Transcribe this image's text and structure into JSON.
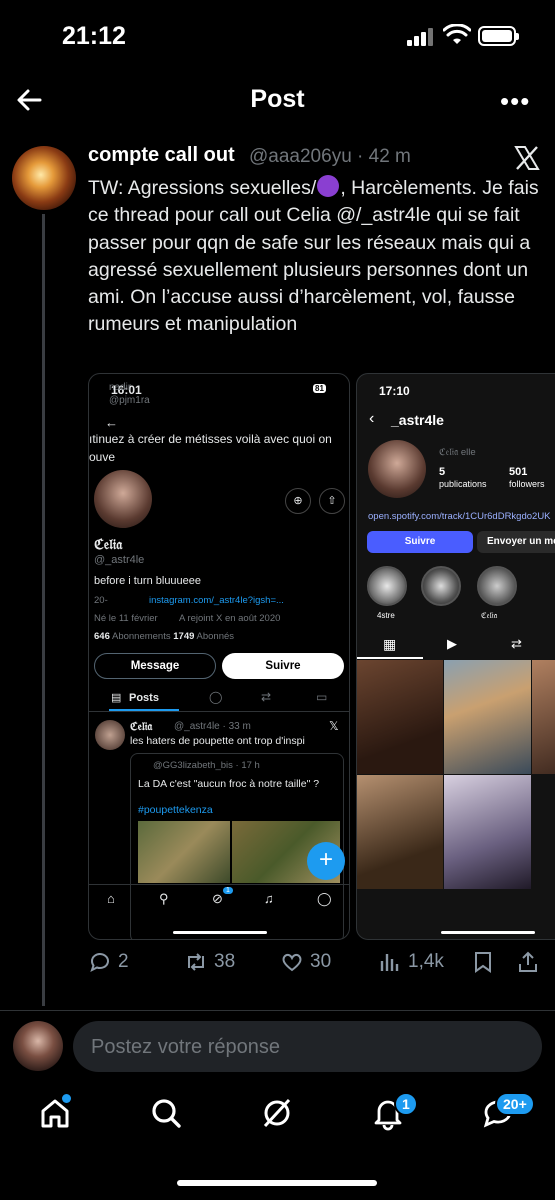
{
  "status_bar": {
    "time": "21:12"
  },
  "header": {
    "title": "Post"
  },
  "post": {
    "author_name": "compte call out",
    "handle_time": "@aaa206yu · 42 m",
    "text_1": "TW: Agressions sexuelles/",
    "text_2": ", Harcèlements. Je fais ce thread pour call out Celia @/_astr4le qui se fait passer pour qqn de safe sur les réseaux mais qui a agressé sexuellement plusieurs personnes dont un ami. On l’accuse aussi d’harcèlement, vol, fausse rumeurs et manipulation",
    "emoji_color": "#8a3fd1"
  },
  "shot1": {
    "time": "16:01",
    "battery": "81",
    "top_name": "nadir",
    "top_handle": "@pjm1ra",
    "fragment_1": "ıtinuez à créer de métisses voilà avec quoi on",
    "fragment_2": "ouve",
    "display_name": "ℭ𝔢𝔩𝔦𝔞",
    "username": "@_astr4le",
    "bio": "before i turn bluuueee",
    "location": "20-",
    "link": "instagram.com/_astr4le?igsh=...",
    "born": "Né le 11 février",
    "joined": "A rejoint X en août 2020",
    "following_count": "646",
    "following_label": "Abonnements",
    "followers_count": "1749",
    "followers_label": "Abonnés",
    "message_btn": "Message",
    "follow_btn": "Suivre",
    "tab_posts": "Posts",
    "tweet_name": "ℭ𝔢𝔩𝔦𝔞",
    "tweet_handle": "@_astr4le · 33 m",
    "tweet_text": "les haters de poupette ont trop d'inspi",
    "quote_handle": "@GG3lizabeth_bis · 17 h",
    "quote_text": "La DA c'est \"aucun froc à notre taille\" ?",
    "quote_tag": "#poupettekenza",
    "notif_badge": "1"
  },
  "shot2": {
    "time": "17:10",
    "username": "_astr4le",
    "display_name": "ℭ𝔢𝔩𝔦𝔞 elle",
    "posts_count": "5",
    "posts_label": "publications",
    "followers_count": "501",
    "followers_label": "followers",
    "link": "open.spotify.com/track/1CUr6dDRkgdo2UK",
    "follow_btn": "Suivre",
    "message_btn": "Envoyer un mess",
    "highlight_1": "4stre",
    "highlight_3": "ℭ𝔢𝔩𝔦𝔞"
  },
  "actions": {
    "replies": "2",
    "reposts": "38",
    "likes": "30",
    "views": "1,4k"
  },
  "reply_box": {
    "placeholder": "Postez votre réponse"
  },
  "tabbar": {
    "notif_badge": "1",
    "messages_badge": "20+"
  },
  "colors": {
    "accent": "#1d9bf0",
    "background": "#000000",
    "muted": "#71767b"
  }
}
